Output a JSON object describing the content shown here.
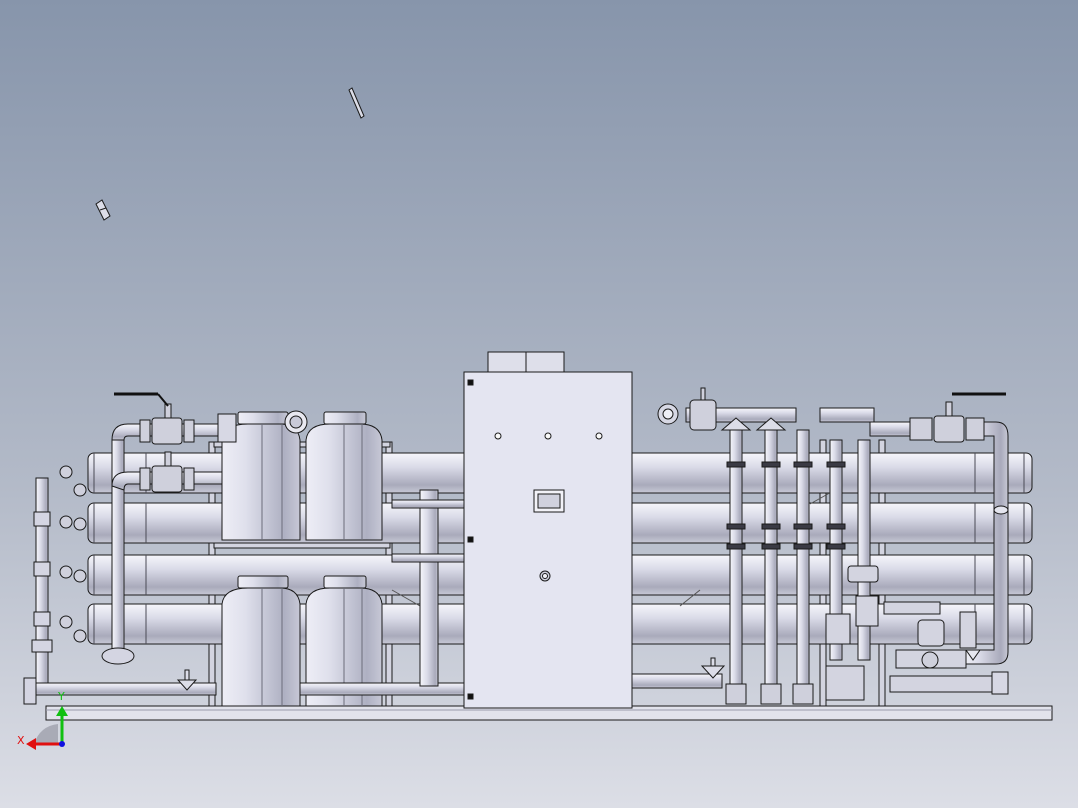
{
  "viewport": {
    "background_top": "#8795ab",
    "background_bottom": "#d9dbe3",
    "model_fill": "#d9dbe8",
    "model_stroke": "#1a1a1a"
  },
  "triad": {
    "x_label": "X",
    "y_label": "Y",
    "x_color": "#e01010",
    "y_color": "#10c010",
    "z_color": "#1010e0"
  }
}
